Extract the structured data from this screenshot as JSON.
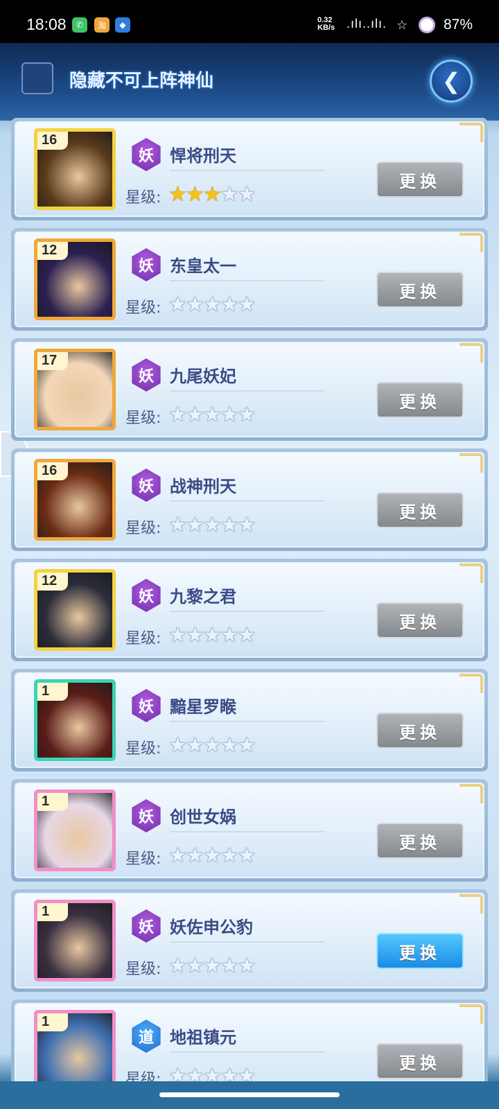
{
  "status_bar": {
    "time": "18:08",
    "net_speed_value": "0.32",
    "net_speed_unit": "KB/s",
    "signal": ".ılı..ılı.",
    "battery": "87%",
    "taobao_glyph": "淘"
  },
  "header": {
    "hide_label": "隐藏不可上阵神仙",
    "back_icon": "back-arrow-icon"
  },
  "star_label": "星级:",
  "cards": [
    {
      "level": "16",
      "badge": "妖",
      "name": "悍将刑天",
      "stars": 3,
      "button": "更换",
      "button_active": false,
      "frame": "#f4d341"
    },
    {
      "level": "12",
      "badge": "妖",
      "name": "东皇太一",
      "stars": 0,
      "button": "更换",
      "button_active": false,
      "frame": "#f0a83a"
    },
    {
      "level": "17",
      "badge": "妖",
      "name": "九尾妖妃",
      "stars": 0,
      "button": "更换",
      "button_active": false,
      "frame": "#f0a83a"
    },
    {
      "level": "16",
      "badge": "妖",
      "name": "战神刑天",
      "stars": 0,
      "button": "更换",
      "button_active": false,
      "frame": "#f0a83a"
    },
    {
      "level": "12",
      "badge": "妖",
      "name": "九黎之君",
      "stars": 0,
      "button": "更换",
      "button_active": false,
      "frame": "#f4d341"
    },
    {
      "level": "1",
      "badge": "妖",
      "name": "黯星罗睺",
      "stars": 0,
      "button": "更换",
      "button_active": false,
      "frame": "#3fd2b4"
    },
    {
      "level": "1",
      "badge": "妖",
      "name": "创世女娲",
      "stars": 0,
      "button": "更换",
      "button_active": false,
      "frame": "#f08fc8"
    },
    {
      "level": "1",
      "badge": "妖",
      "name": "妖佐申公豹",
      "stars": 0,
      "button": "更换",
      "button_active": true,
      "frame": "#f08fc8"
    },
    {
      "level": "1",
      "badge": "道",
      "name": "地祖镇元",
      "stars": 0,
      "button": "更换",
      "button_active": false,
      "frame": "#f08fc8"
    }
  ]
}
